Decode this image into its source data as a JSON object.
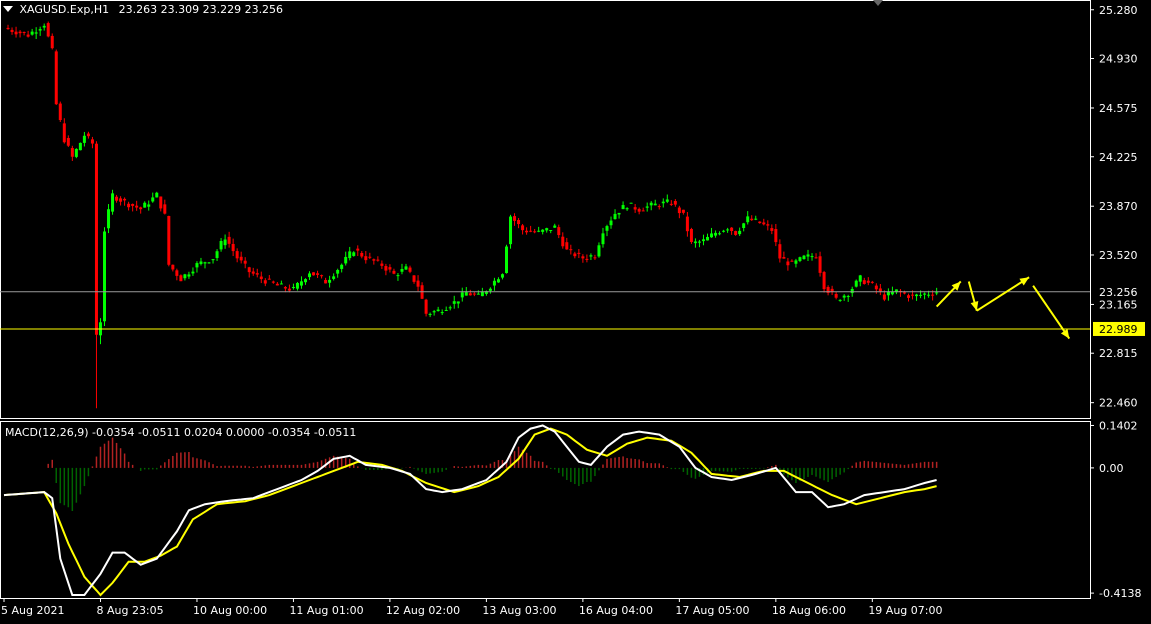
{
  "window": {
    "title": "XAGUSD.Exp,H1",
    "ohlc": "23.263 23.309 23.229 23.256",
    "menu_arrow_icon": "triangle-down-icon"
  },
  "colors": {
    "background": "#000000",
    "frame": "#ffffff",
    "bull": "#00ff00",
    "bear": "#ff0000",
    "macd_hist_pos": "#b22222",
    "macd_hist_neg": "#006400",
    "macd_line": "#ffffff",
    "signal_line": "#ffff00",
    "bid_line": "#9a9a9a",
    "level_line": "#ffff00",
    "level_label_bg": "#ffff00",
    "arrows": "#ffff00"
  },
  "chart_data": [
    {
      "type": "candlestick",
      "symbol": "XAGUSD.Exp",
      "timeframe": "H1",
      "y_ticks": [
        "25.280",
        "24.930",
        "24.575",
        "24.225",
        "23.870",
        "23.520",
        "23.165",
        "22.815",
        "22.460"
      ],
      "ylim": [
        22.35,
        25.35
      ],
      "current_price": 23.256,
      "current_price_label": "23.256",
      "level": 22.989,
      "level_label": "22.989",
      "x_labels": [
        "5 Aug 2021",
        "8 Aug 23:05",
        "10 Aug 00:00",
        "11 Aug 01:00",
        "12 Aug 02:00",
        "13 Aug 03:00",
        "16 Aug 04:00",
        "17 Aug 05:00",
        "18 Aug 06:00",
        "19 Aug 07:00"
      ],
      "bars_per_label": 12,
      "close_path": [
        [
          0,
          25.15
        ],
        [
          6,
          25.1
        ],
        [
          10,
          25.18
        ],
        [
          12,
          24.98
        ],
        [
          13,
          24.6
        ],
        [
          15,
          24.35
        ],
        [
          17,
          24.22
        ],
        [
          20,
          24.38
        ],
        [
          22,
          24.32
        ],
        [
          23,
          22.95
        ],
        [
          24,
          23.05
        ],
        [
          25,
          23.7
        ],
        [
          27,
          23.95
        ],
        [
          30,
          23.9
        ],
        [
          34,
          23.85
        ],
        [
          38,
          23.95
        ],
        [
          40,
          23.8
        ],
        [
          41,
          23.45
        ],
        [
          44,
          23.35
        ],
        [
          48,
          23.45
        ],
        [
          52,
          23.5
        ],
        [
          55,
          23.65
        ],
        [
          58,
          23.5
        ],
        [
          61,
          23.4
        ],
        [
          64,
          23.35
        ],
        [
          68,
          23.3
        ],
        [
          72,
          23.27
        ],
        [
          76,
          23.4
        ],
        [
          80,
          23.33
        ],
        [
          84,
          23.45
        ],
        [
          87,
          23.56
        ],
        [
          90,
          23.5
        ],
        [
          94,
          23.45
        ],
        [
          97,
          23.38
        ],
        [
          100,
          23.42
        ],
        [
          103,
          23.3
        ],
        [
          105,
          23.1
        ],
        [
          108,
          23.12
        ],
        [
          112,
          23.18
        ],
        [
          115,
          23.25
        ],
        [
          118,
          23.22
        ],
        [
          121,
          23.3
        ],
        [
          124,
          23.4
        ],
        [
          126,
          23.8
        ],
        [
          129,
          23.7
        ],
        [
          133,
          23.68
        ],
        [
          137,
          23.72
        ],
        [
          140,
          23.55
        ],
        [
          144,
          23.5
        ],
        [
          147,
          23.52
        ],
        [
          149,
          23.7
        ],
        [
          152,
          23.82
        ],
        [
          155,
          23.88
        ],
        [
          158,
          23.85
        ],
        [
          162,
          23.88
        ],
        [
          166,
          23.9
        ],
        [
          169,
          23.8
        ],
        [
          171,
          23.6
        ],
        [
          174,
          23.62
        ],
        [
          177,
          23.68
        ],
        [
          180,
          23.72
        ],
        [
          182,
          23.68
        ],
        [
          185,
          23.78
        ],
        [
          188,
          23.75
        ],
        [
          191,
          23.7
        ],
        [
          193,
          23.5
        ],
        [
          196,
          23.45
        ],
        [
          199,
          23.5
        ],
        [
          202,
          23.52
        ],
        [
          204,
          23.3
        ],
        [
          207,
          23.2
        ],
        [
          210,
          23.25
        ],
        [
          213,
          23.35
        ],
        [
          216,
          23.3
        ],
        [
          219,
          23.22
        ],
        [
          222,
          23.26
        ],
        [
          226,
          23.22
        ],
        [
          229,
          23.24
        ],
        [
          232,
          23.256
        ]
      ],
      "spikes": [
        [
          23,
          22.42
        ],
        [
          24,
          22.88
        ]
      ]
    },
    {
      "type": "macd",
      "title": "MACD(12,26,9) -0.0354 -0.0511 0.0204 0.0000 -0.0354 -0.0511",
      "y_ticks": [
        "0.1402",
        "0.00",
        "-0.4138"
      ],
      "ylim": [
        -0.43,
        0.155
      ],
      "macd": [
        [
          0,
          -0.09
        ],
        [
          10,
          -0.08
        ],
        [
          12,
          -0.1
        ],
        [
          14,
          -0.3
        ],
        [
          17,
          -0.42
        ],
        [
          20,
          -0.42
        ],
        [
          24,
          -0.35
        ],
        [
          27,
          -0.28
        ],
        [
          30,
          -0.28
        ],
        [
          34,
          -0.32
        ],
        [
          38,
          -0.3
        ],
        [
          43,
          -0.21
        ],
        [
          46,
          -0.14
        ],
        [
          50,
          -0.12
        ],
        [
          55,
          -0.11
        ],
        [
          62,
          -0.1
        ],
        [
          68,
          -0.07
        ],
        [
          74,
          -0.04
        ],
        [
          78,
          -0.01
        ],
        [
          82,
          0.03
        ],
        [
          86,
          0.04
        ],
        [
          90,
          0.01
        ],
        [
          96,
          0.0
        ],
        [
          101,
          -0.02
        ],
        [
          105,
          -0.07
        ],
        [
          109,
          -0.08
        ],
        [
          114,
          -0.07
        ],
        [
          120,
          -0.04
        ],
        [
          125,
          0.02
        ],
        [
          128,
          0.1
        ],
        [
          131,
          0.13
        ],
        [
          134,
          0.14
        ],
        [
          137,
          0.12
        ],
        [
          140,
          0.07
        ],
        [
          143,
          0.02
        ],
        [
          146,
          0.01
        ],
        [
          150,
          0.07
        ],
        [
          154,
          0.11
        ],
        [
          158,
          0.12
        ],
        [
          163,
          0.11
        ],
        [
          168,
          0.07
        ],
        [
          172,
          0.0
        ],
        [
          176,
          -0.03
        ],
        [
          181,
          -0.04
        ],
        [
          187,
          -0.02
        ],
        [
          192,
          0.0
        ],
        [
          197,
          -0.08
        ],
        [
          201,
          -0.08
        ],
        [
          205,
          -0.13
        ],
        [
          209,
          -0.12
        ],
        [
          214,
          -0.09
        ],
        [
          219,
          -0.08
        ],
        [
          224,
          -0.07
        ],
        [
          229,
          -0.05
        ],
        [
          232,
          -0.04
        ]
      ],
      "signal": [
        [
          0,
          -0.09
        ],
        [
          10,
          -0.08
        ],
        [
          13,
          -0.15
        ],
        [
          16,
          -0.25
        ],
        [
          20,
          -0.36
        ],
        [
          24,
          -0.42
        ],
        [
          27,
          -0.38
        ],
        [
          31,
          -0.31
        ],
        [
          35,
          -0.31
        ],
        [
          39,
          -0.29
        ],
        [
          43,
          -0.26
        ],
        [
          47,
          -0.17
        ],
        [
          53,
          -0.12
        ],
        [
          60,
          -0.11
        ],
        [
          66,
          -0.09
        ],
        [
          72,
          -0.06
        ],
        [
          78,
          -0.03
        ],
        [
          84,
          0.0
        ],
        [
          88,
          0.02
        ],
        [
          94,
          0.01
        ],
        [
          99,
          -0.01
        ],
        [
          105,
          -0.05
        ],
        [
          112,
          -0.08
        ],
        [
          118,
          -0.06
        ],
        [
          123,
          -0.03
        ],
        [
          128,
          0.03
        ],
        [
          132,
          0.11
        ],
        [
          136,
          0.13
        ],
        [
          140,
          0.11
        ],
        [
          145,
          0.06
        ],
        [
          150,
          0.04
        ],
        [
          155,
          0.08
        ],
        [
          160,
          0.1
        ],
        [
          166,
          0.09
        ],
        [
          171,
          0.05
        ],
        [
          176,
          -0.02
        ],
        [
          183,
          -0.03
        ],
        [
          189,
          -0.01
        ],
        [
          194,
          -0.01
        ],
        [
          200,
          -0.05
        ],
        [
          206,
          -0.09
        ],
        [
          212,
          -0.12
        ],
        [
          218,
          -0.1
        ],
        [
          224,
          -0.08
        ],
        [
          229,
          -0.07
        ],
        [
          232,
          -0.06
        ]
      ],
      "histogram_pos": "#b22222",
      "histogram_neg": "#006400"
    }
  ],
  "forecast_arrows": [
    {
      "points": [
        [
          23.15,
          232
        ],
        [
          23.33,
          238
        ]
      ]
    },
    {
      "points": [
        [
          23.33,
          240
        ],
        [
          23.12,
          242
        ]
      ]
    },
    {
      "points": [
        [
          23.12,
          242
        ],
        [
          23.36,
          255
        ]
      ]
    },
    {
      "points": [
        [
          23.3,
          256
        ],
        [
          22.92,
          265
        ]
      ]
    }
  ]
}
